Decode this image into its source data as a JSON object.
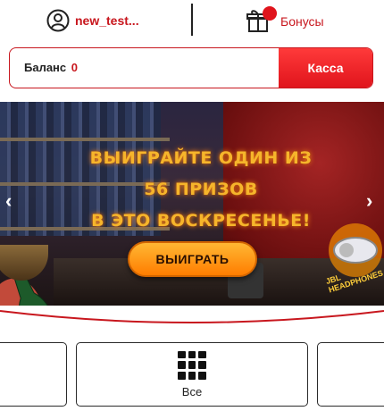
{
  "header": {
    "username": "new_test...",
    "bonus_label": "Бонусы",
    "bonus_badge_symbol": "₽"
  },
  "balance": {
    "label": "Баланс",
    "value": "0",
    "cashier_label": "Касса"
  },
  "banner": {
    "promo_lines": [
      "ВЫИГРАЙТЕ ОДИН ИЗ",
      "56 ПРИЗОВ",
      "В ЭТО ВОСКРЕСЕНЬЕ!"
    ],
    "cta_label": "ВЫИГРАТЬ",
    "prev_arrow": "‹",
    "next_arrow": "›",
    "prize_caption": "JBL HEADPHONES"
  },
  "categories": {
    "items": [
      {
        "label": ""
      },
      {
        "label": "Все",
        "icon": "grid-icon"
      },
      {
        "label": ""
      }
    ]
  },
  "colors": {
    "brand_red": "#c8171e",
    "promo_gold": "#f6b52b",
    "cta_orange": "#ff8a00"
  }
}
